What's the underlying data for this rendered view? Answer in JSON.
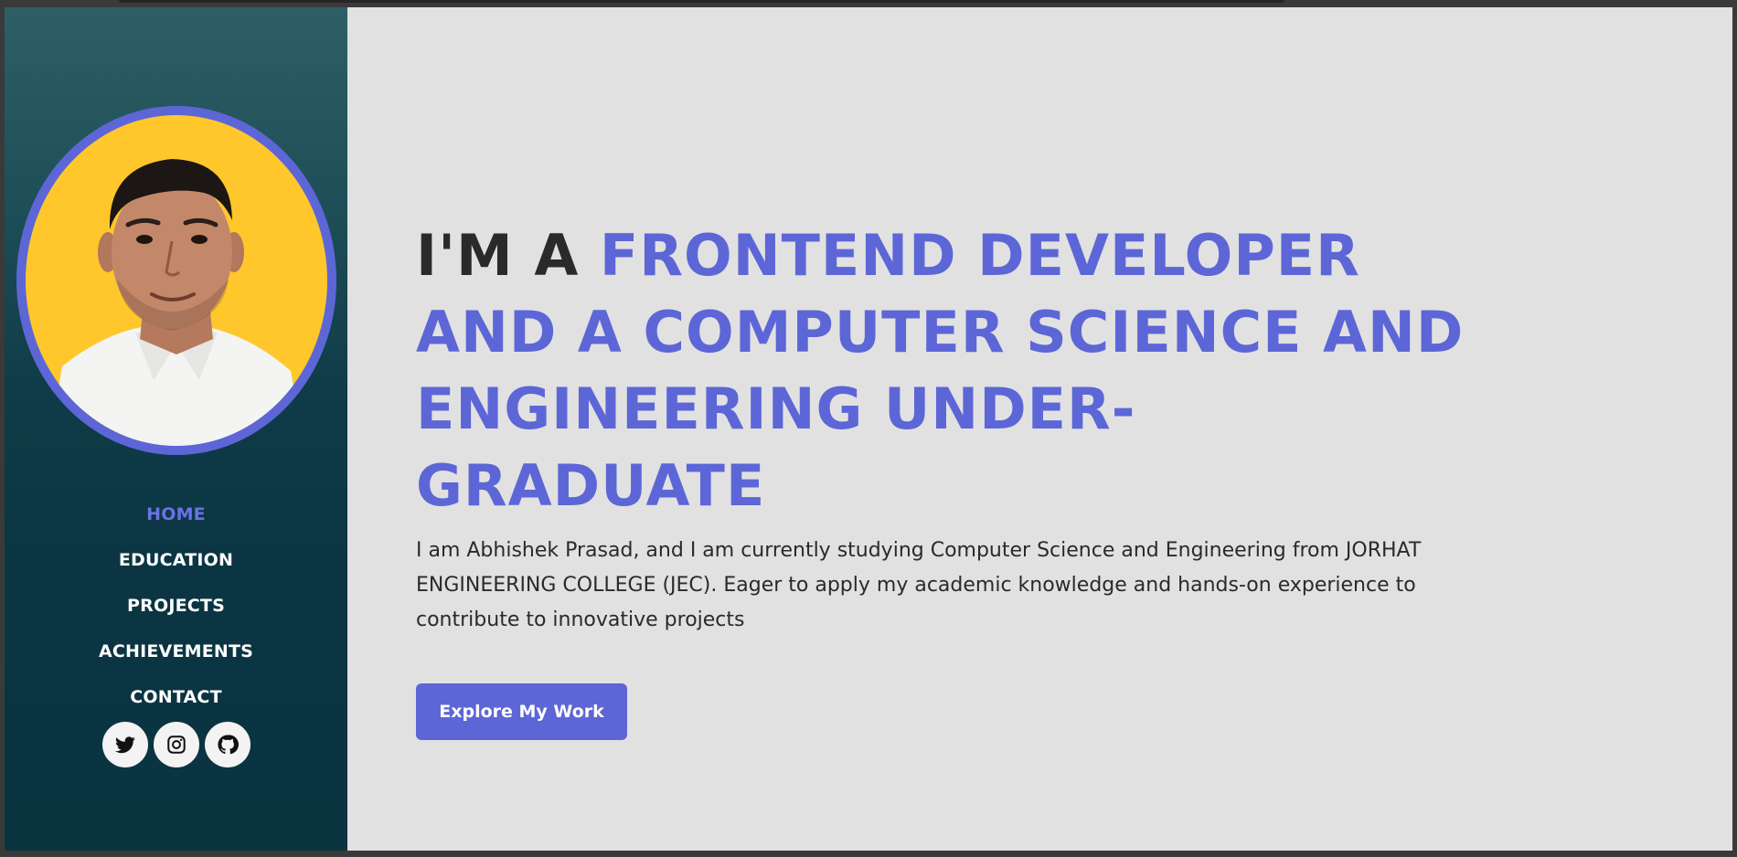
{
  "sidebar": {
    "avatar_alt": "Abhishek Prasad",
    "nav": [
      {
        "label": "HOME",
        "active": true
      },
      {
        "label": "EDUCATION",
        "active": false
      },
      {
        "label": "PROJECTS",
        "active": false
      },
      {
        "label": "ACHIEVEMENTS",
        "active": false
      },
      {
        "label": "CONTACT",
        "active": false
      }
    ],
    "socials": [
      {
        "icon": "twitter-icon"
      },
      {
        "icon": "instagram-icon"
      },
      {
        "icon": "github-icon"
      }
    ]
  },
  "hero": {
    "headline_lead": "I'M A ",
    "headline_accent_1": "FRONTEND DEVELOPER",
    "headline_accent_2": "AND A COMPUTER SCIENCE AND",
    "headline_accent_3": "ENGINEERING UNDER-GRADUATE",
    "bio": "I am Abhishek Prasad, and I am currently studying Computer Science and Engineering from JORHAT ENGINEERING COLLEGE (JEC). Eager to apply my academic knowledge and hands-on experience to contribute to innovative projects",
    "cta_label": "Explore My Work"
  },
  "colors": {
    "accent": "#5d66d6",
    "avatar_background": "#ffc72c",
    "sidebar_dark": "#0a3440",
    "page_background": "#e1e1e1"
  }
}
